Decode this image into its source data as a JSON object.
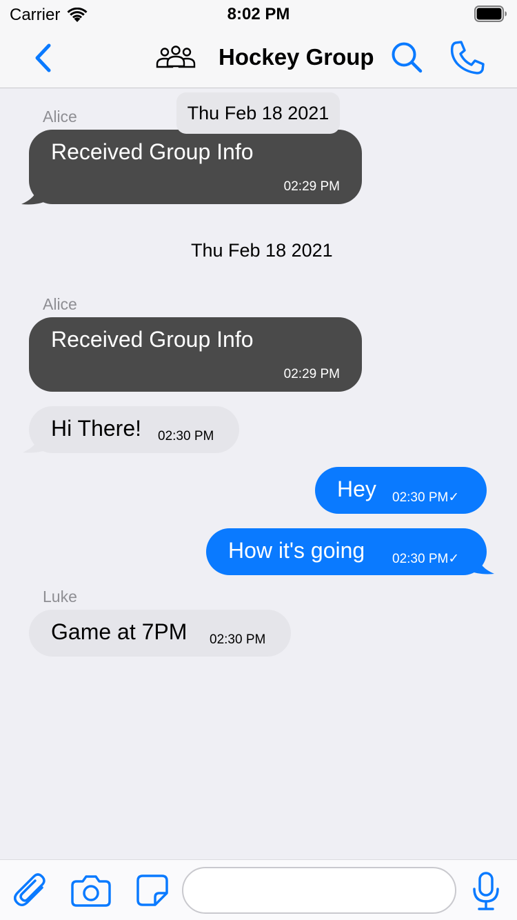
{
  "status_bar": {
    "carrier": "Carrier",
    "time": "8:02 PM"
  },
  "nav": {
    "title": "Hockey Group",
    "icons": [
      "chevron-left-icon",
      "group-icon",
      "search-icon",
      "phone-icon"
    ]
  },
  "colors": {
    "accent": "#0a7aff",
    "received_dark": "#4a4a4a",
    "received_light": "#e5e5ea",
    "background": "#efeff4"
  },
  "chat": {
    "sticky_date": "Thu Feb 18 2021",
    "date_separator": "Thu Feb 18 2021",
    "messages": [
      {
        "sender": "Alice",
        "text": "Received Group Info",
        "time": "02:29 PM",
        "type": "system-received"
      },
      {
        "sender": "Alice",
        "text": "Received Group Info",
        "time": "02:29 PM",
        "type": "system-received"
      },
      {
        "sender": "",
        "text": "Hi There!",
        "time": "02:30 PM",
        "type": "received"
      },
      {
        "sender": "",
        "text": "Hey",
        "time": "02:30 PM✓",
        "type": "sent"
      },
      {
        "sender": "",
        "text": "How it's going",
        "time": "02:30 PM✓",
        "type": "sent"
      },
      {
        "sender": "Luke",
        "text": "Game at 7PM",
        "time": "02:30 PM",
        "type": "received"
      }
    ]
  },
  "input_bar": {
    "icons": [
      "paperclip-icon",
      "camera-icon",
      "sticker-icon",
      "microphone-icon"
    ],
    "message_value": "",
    "message_placeholder": ""
  }
}
